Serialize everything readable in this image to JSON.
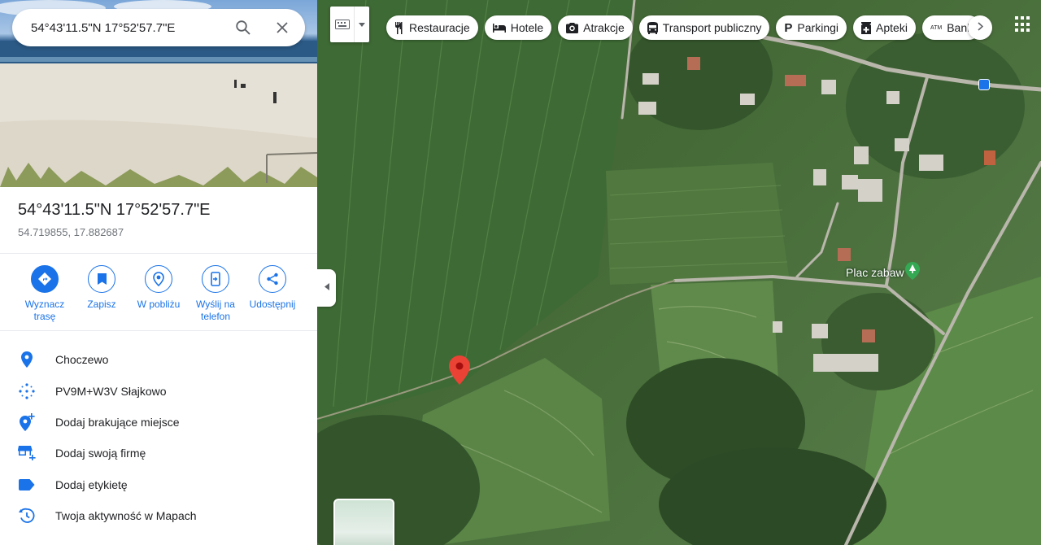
{
  "search": {
    "value": "54°43'11.5\"N 17°52'57.7\"E",
    "search_icon": "search-icon",
    "clear_icon": "close-icon"
  },
  "place": {
    "title": "54°43'11.5\"N 17°52'57.7\"E",
    "decimal": "54.719855, 17.882687"
  },
  "actions": [
    {
      "label": "Wyznacz trasę",
      "icon": "directions-icon"
    },
    {
      "label": "Zapisz",
      "icon": "bookmark-icon"
    },
    {
      "label": "W pobliżu",
      "icon": "nearby-icon"
    },
    {
      "label": "Wyślij na telefon",
      "icon": "send-to-phone-icon"
    },
    {
      "label": "Udostępnij",
      "icon": "share-icon"
    }
  ],
  "info": [
    {
      "text": "Choczewo",
      "icon": "location-pin-icon"
    },
    {
      "text": "PV9M+W3V Słajkowo",
      "icon": "plus-code-icon"
    },
    {
      "text": "Dodaj brakujące miejsce",
      "icon": "add-place-icon"
    },
    {
      "text": "Dodaj swoją firmę",
      "icon": "add-business-icon"
    },
    {
      "text": "Dodaj etykietę",
      "icon": "label-icon"
    },
    {
      "text": "Twoja aktywność w Mapach",
      "icon": "history-icon"
    }
  ],
  "chips": [
    {
      "label": "Restauracje",
      "icon": "restaurant-icon"
    },
    {
      "label": "Hotele",
      "icon": "hotel-icon"
    },
    {
      "label": "Atrakcje",
      "icon": "camera-icon"
    },
    {
      "label": "Transport publiczny",
      "icon": "bus-icon"
    },
    {
      "label": "Parkingi",
      "icon": "parking-icon"
    },
    {
      "label": "Apteki",
      "icon": "pharmacy-icon"
    },
    {
      "label": "Bank",
      "icon": "atm-icon"
    }
  ],
  "map": {
    "poi_label": "Plac zabaw",
    "accent_color": "#1a73e8",
    "pin_color": "#ea4335"
  }
}
